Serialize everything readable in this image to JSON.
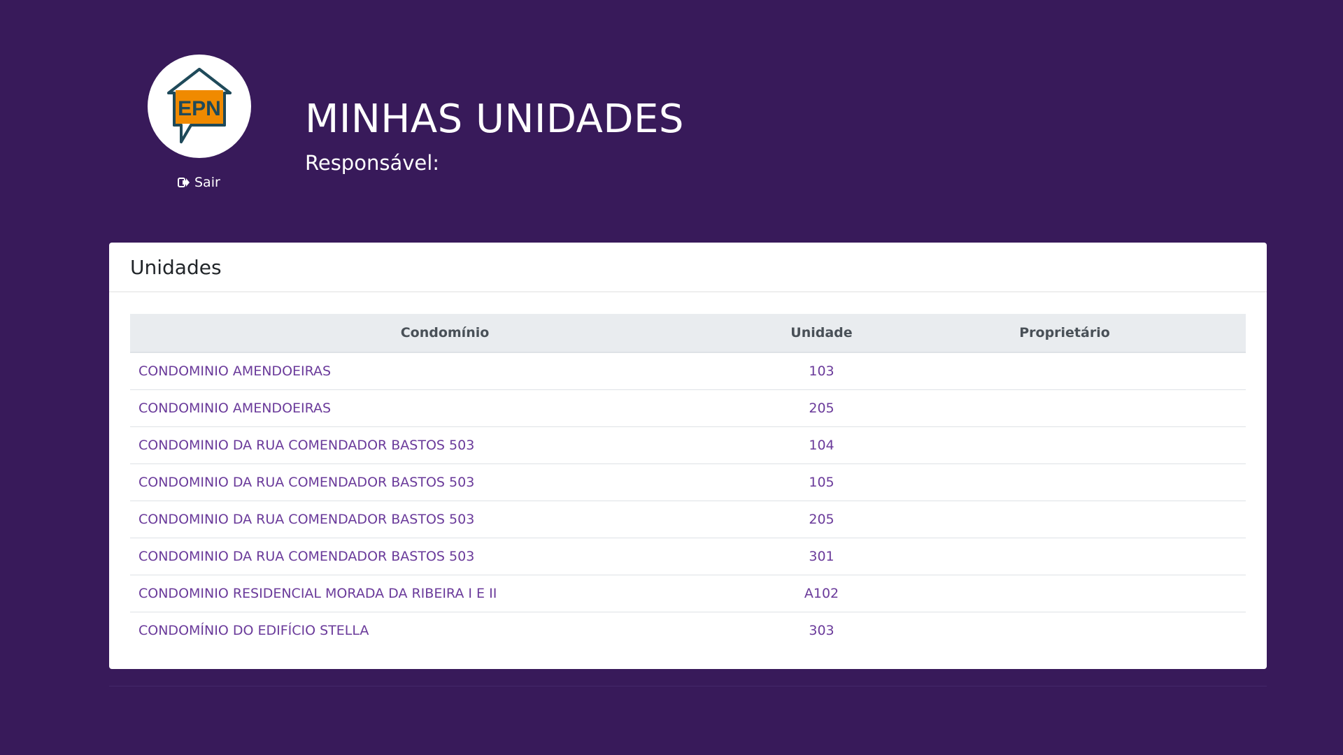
{
  "header": {
    "logo_text": "EPN",
    "logout_label": "Sair",
    "title": "MINHAS UNIDADES",
    "subtitle": "Responsável:"
  },
  "card": {
    "title": "Unidades"
  },
  "table": {
    "columns": [
      "Condomínio",
      "Unidade",
      "Proprietário"
    ],
    "rows": [
      {
        "condominio": "CONDOMINIO AMENDOEIRAS",
        "unidade": "103",
        "proprietario": ""
      },
      {
        "condominio": "CONDOMINIO AMENDOEIRAS",
        "unidade": "205",
        "proprietario": ""
      },
      {
        "condominio": "CONDOMINIO DA RUA COMENDADOR BASTOS 503",
        "unidade": "104",
        "proprietario": ""
      },
      {
        "condominio": "CONDOMINIO DA RUA COMENDADOR BASTOS 503",
        "unidade": "105",
        "proprietario": ""
      },
      {
        "condominio": "CONDOMINIO DA RUA COMENDADOR BASTOS 503",
        "unidade": "205",
        "proprietario": ""
      },
      {
        "condominio": "CONDOMINIO DA RUA COMENDADOR BASTOS 503",
        "unidade": "301",
        "proprietario": ""
      },
      {
        "condominio": "CONDOMINIO RESIDENCIAL MORADA DA RIBEIRA I E II",
        "unidade": "A102",
        "proprietario": ""
      },
      {
        "condominio": "CONDOMÍNIO DO EDIFÍCIO STELLA",
        "unidade": "303",
        "proprietario": ""
      }
    ]
  },
  "icons": {
    "logout": "sign-out-icon",
    "logo": "epn-house-logo"
  },
  "colors": {
    "background": "#381a5a",
    "link": "#6a3a9a",
    "logo_orange": "#f08a00",
    "logo_outline": "#1f4a5a"
  }
}
